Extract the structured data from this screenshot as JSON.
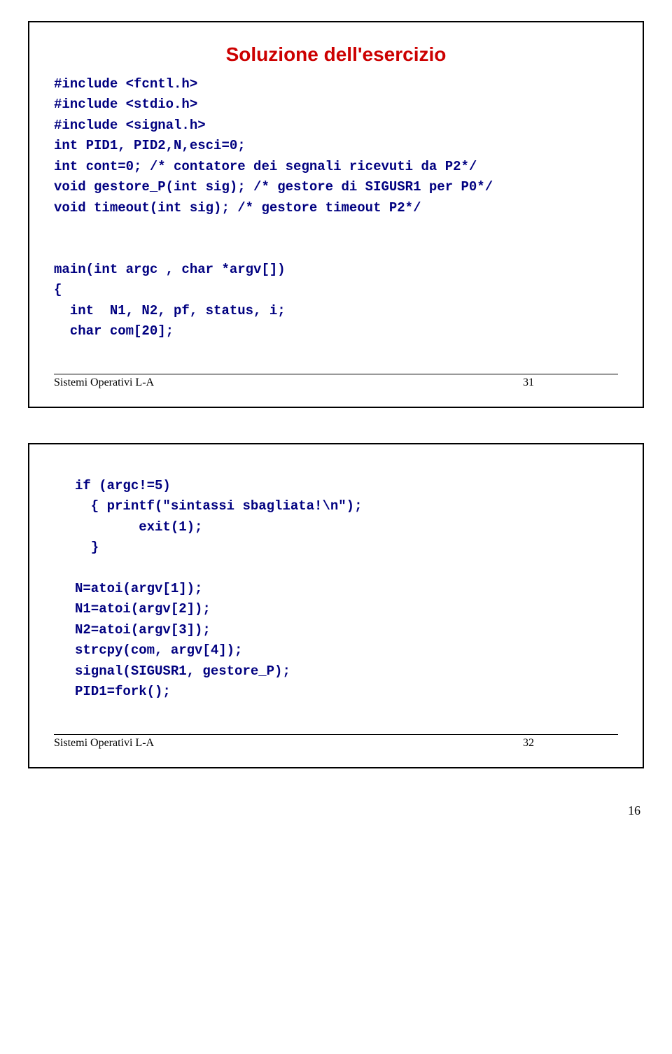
{
  "slide1": {
    "title": "Soluzione dell'esercizio",
    "code": "#include <fcntl.h>\n#include <stdio.h>\n#include <signal.h>\nint PID1, PID2,N,esci=0;\nint cont=0; /* contatore dei segnali ricevuti da P2*/\nvoid gestore_P(int sig); /* gestore di SIGUSR1 per P0*/\nvoid timeout(int sig); /* gestore timeout P2*/\n\n\nmain(int argc , char *argv[])\n{\n  int  N1, N2, pf, status, i;\n  char com[20];",
    "footer_label": "Sistemi Operativi L-A",
    "footer_num": "31"
  },
  "slide2": {
    "code": "if (argc!=5)\n  { printf(\"sintassi sbagliata!\\n\");\n        exit(1);\n  }\n\nN=atoi(argv[1]);\nN1=atoi(argv[2]);\nN2=atoi(argv[3]);\nstrcpy(com, argv[4]);\nsignal(SIGUSR1, gestore_P);\nPID1=fork();",
    "footer_label": "Sistemi Operativi L-A",
    "footer_num": "32"
  },
  "page_number": "16"
}
